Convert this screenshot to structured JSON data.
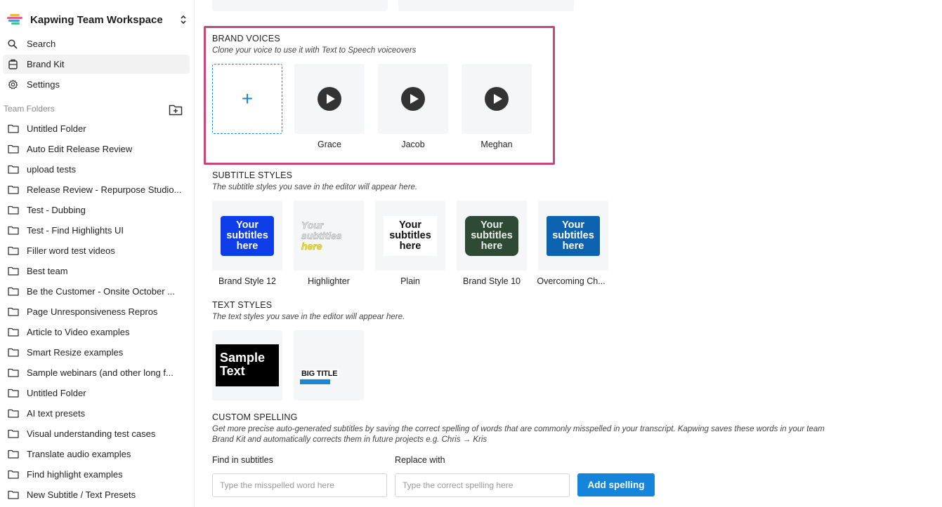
{
  "workspace": {
    "name": "Kapwing Team Workspace"
  },
  "nav": [
    {
      "label": "Search",
      "icon": "search-icon"
    },
    {
      "label": "Brand Kit",
      "icon": "brand-kit-icon",
      "active": true
    },
    {
      "label": "Settings",
      "icon": "gear-icon"
    }
  ],
  "team_folders": {
    "label": "Team Folders",
    "items": [
      "Untitled Folder",
      "Auto Edit Release Review",
      "upload tests",
      "Release Review - Repurpose Studio...",
      "Test - Dubbing",
      "Test - Find Highlights UI",
      "Filler word test videos",
      "Best team",
      "Be the Customer - Onsite October ...",
      "Page Unresponsiveness Repros",
      "Article to Video examples",
      "Smart Resize examples",
      "Sample webinars (and other long f...",
      "Untitled Folder",
      "AI text presets",
      "Visual understanding test cases",
      "Translate audio examples",
      "Find highlight examples",
      "New Subtitle / Text Presets"
    ]
  },
  "brand_voices": {
    "title": "BRAND VOICES",
    "subtitle": "Clone your voice to use it with Text to Speech voiceovers",
    "add_symbol": "+",
    "voices": [
      "Grace",
      "Jacob",
      "Meghan"
    ]
  },
  "subtitle_styles": {
    "title": "SUBTITLE STYLES",
    "subtitle": "The subtitle styles you save in the editor will appear here.",
    "preview_lines": [
      "Your",
      "subtitles",
      "here"
    ],
    "styles": [
      "Brand Style 12",
      "Highlighter",
      "Plain",
      "Brand Style 10",
      "Overcoming Ch..."
    ]
  },
  "text_styles": {
    "title": "TEXT STYLES",
    "subtitle": "The text styles you save in the editor will appear here.",
    "sample": [
      "Sample",
      "Text"
    ],
    "big_title": "BIG TITLE"
  },
  "custom_spelling": {
    "title": "CUSTOM SPELLING",
    "description_line1": "Get more precise auto-generated subtitles by saving the correct spelling of words that are commonly misspelled in your transcript. Kapwing saves these words in your team",
    "description_line2": "Brand Kit and automatically corrects them in future projects e.g. Chris → Kris",
    "find_label": "Find in subtitles",
    "find_placeholder": "Type the misspelled word here",
    "replace_label": "Replace with",
    "replace_placeholder": "Type the correct spelling here",
    "button": "Add spelling"
  },
  "colors": {
    "highlight_border": "#c6487b",
    "accent": "#1585dc",
    "brand_style_12": "#0f3ee8",
    "brand_style_10": "#2e4a34",
    "overcoming": "#0d63b0",
    "highlighter_yellow": "#f2e130"
  }
}
